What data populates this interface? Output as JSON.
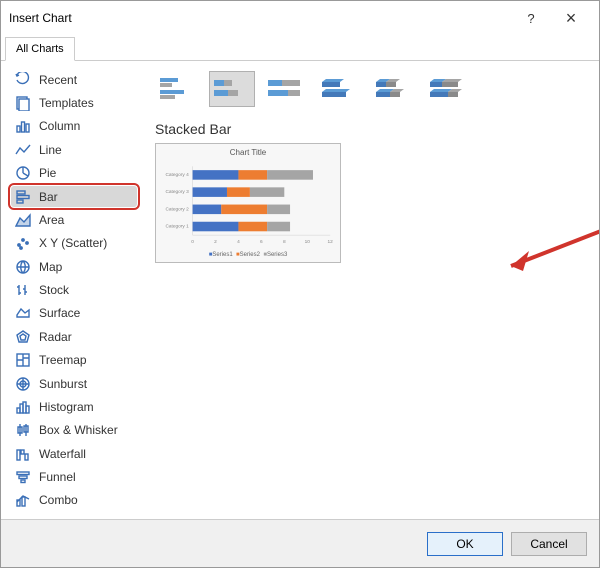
{
  "dialog": {
    "title": "Insert Chart",
    "help": "?",
    "close": "×"
  },
  "tabs": {
    "all_charts": "All Charts"
  },
  "sidebar": {
    "items": [
      {
        "label": "Recent"
      },
      {
        "label": "Templates"
      },
      {
        "label": "Column"
      },
      {
        "label": "Line"
      },
      {
        "label": "Pie"
      },
      {
        "label": "Bar"
      },
      {
        "label": "Area"
      },
      {
        "label": "X Y (Scatter)"
      },
      {
        "label": "Map"
      },
      {
        "label": "Stock"
      },
      {
        "label": "Surface"
      },
      {
        "label": "Radar"
      },
      {
        "label": "Treemap"
      },
      {
        "label": "Sunburst"
      },
      {
        "label": "Histogram"
      },
      {
        "label": "Box & Whisker"
      },
      {
        "label": "Waterfall"
      },
      {
        "label": "Funnel"
      },
      {
        "label": "Combo"
      }
    ]
  },
  "section_title": "Stacked Bar",
  "preview_title": "Chart Title",
  "chart_data": {
    "type": "bar",
    "orientation": "horizontal",
    "stacked": true,
    "categories": [
      "Category 1",
      "Category 2",
      "Category 3",
      "Category 4"
    ],
    "series": [
      {
        "name": "Series1",
        "values": [
          4,
          2.5,
          3,
          4
        ],
        "color": "#4472c4"
      },
      {
        "name": "Series2",
        "values": [
          2.5,
          4,
          2,
          2.5
        ],
        "color": "#ed7d31"
      },
      {
        "name": "Series3",
        "values": [
          2,
          2,
          3,
          4
        ],
        "color": "#a5a5a5"
      }
    ],
    "xlim": [
      0,
      12
    ],
    "xticks": [
      0,
      2,
      4,
      6,
      8,
      10,
      12
    ]
  },
  "legend": {
    "s1": "Series1",
    "s2": "Series2",
    "s3": "Series3"
  },
  "footer": {
    "ok": "OK",
    "cancel": "Cancel"
  },
  "colors": {
    "series1": "#4472c4",
    "series2": "#ed7d31",
    "series3": "#a5a5a5",
    "highlight": "#d0342c",
    "arrow": "#d0342c"
  }
}
